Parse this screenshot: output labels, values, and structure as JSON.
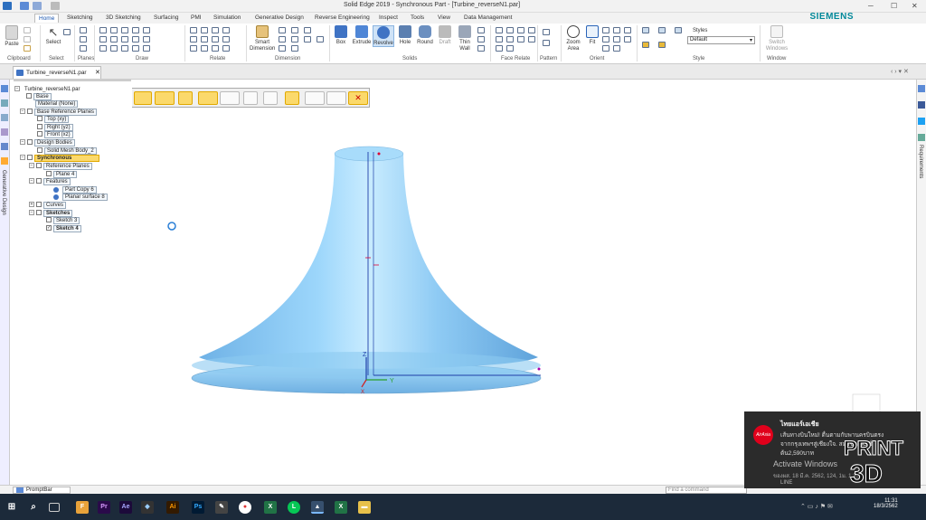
{
  "window": {
    "title": "Solid Edge 2019 - Synchronous Part - [Turbine_reverseN1.par]",
    "brand": "SIEMENS"
  },
  "tabs": [
    "Home",
    "Sketching",
    "3D Sketching",
    "Surfacing",
    "PMI",
    "Simulation",
    "Generative Design",
    "Reverse Engineering",
    "Inspect",
    "Tools",
    "View",
    "Data Management"
  ],
  "ribbon": {
    "groups": [
      "Clipboard",
      "Select",
      "Planes",
      "Draw",
      "Relate",
      "Dimension",
      "Solids",
      "Face Relate",
      "Pattern",
      "Orient",
      "Style",
      "Window"
    ],
    "buttons": {
      "paste": "Paste",
      "select": "Select",
      "smart_dimension": "Smart Dimension",
      "box": "Box",
      "extrude": "Extrude",
      "revolve": "Revolve",
      "hole": "Hole",
      "round": "Round",
      "draft": "Draft",
      "thin_wall": "Thin Wall",
      "zoom_area": "Zoom Area",
      "fit": "Fit",
      "styles": "Styles",
      "switch_windows": "Switch Windows"
    },
    "style_value": "Default"
  },
  "document_tab": "Turbine_reverseN1.par",
  "tree": {
    "root": "Turbine_reverseN1.par",
    "base": "Base",
    "material": "Material (None)",
    "base_ref_planes": "Base Reference Planes",
    "top": "Top (xy)",
    "right": "Right (yz)",
    "front": "Front (xz)",
    "design_bodies": "Design Bodies",
    "mesh_body": "Solid Mesh Body_2",
    "synchronous": "Synchronous",
    "ref_planes": "Reference Planes",
    "plane4": "Plane 4",
    "features": "Features",
    "part_copy": "Part Copy 6",
    "planar_surface": "Planar surface 8",
    "curves": "Curves",
    "sketches": "Sketches",
    "sketch3": "Sketch 3",
    "sketch4": "Sketch 4"
  },
  "sidebars": {
    "left": "Generative Design",
    "right": "Requirements"
  },
  "axes": {
    "z": "Z",
    "y": "Y",
    "x": "X"
  },
  "promptbar": {
    "label": "PromptBar",
    "find_placeholder": "Find a command"
  },
  "notification": {
    "line1": "ไทยแอร์เอเชีย",
    "line2": "เส้นทางบินใหม่! ตื่นตามกับพานครบินตรง",
    "line3": "จากกรุงเทพฯสู่เชียงใจ. สมาชิกBIGเริ่ม",
    "line4": "ต้น2,590บาท",
    "activate": "Activate Windows",
    "goto": "Go to Settings to activate Windows.",
    "date_line": "ของผส. 18 มี.ค. 2562, 124, 1ม. 1,2...",
    "source": "LINE"
  },
  "watermark": {
    "top": "PRINT",
    "bottom": "3D"
  },
  "taskbar": {
    "time": "11:31",
    "date": "18/3/2562"
  },
  "colors": {
    "accent": "#1a56b0",
    "model": "#8ccaf0",
    "highlight": "#fbd96b"
  }
}
